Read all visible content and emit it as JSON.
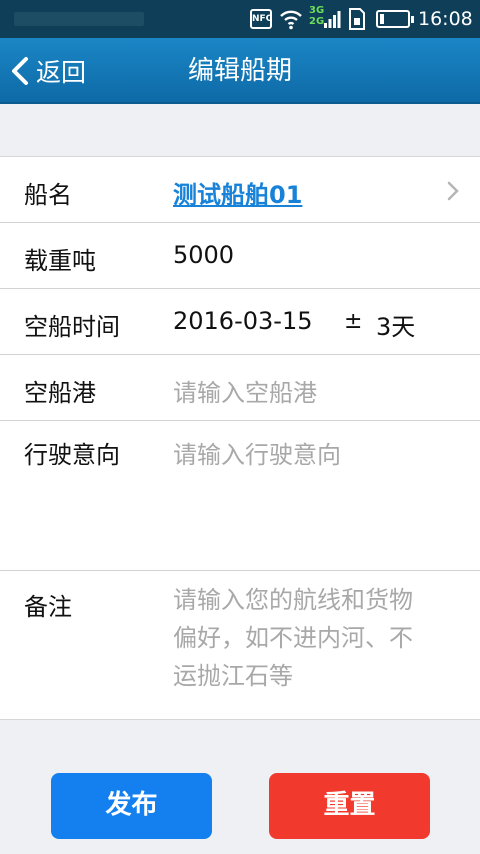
{
  "status_bar": {
    "nfc_label": "NFC",
    "network_type_top": "3G",
    "network_type_bottom": "2G",
    "battery_level_percent": 15,
    "time": "16:08"
  },
  "header": {
    "back_label": "返回",
    "title": "编辑船期"
  },
  "form": {
    "ship_name": {
      "label": "船名",
      "value": "测试船舶01"
    },
    "tonnage": {
      "label": "载重吨",
      "value": "5000"
    },
    "empty_time": {
      "label": "空船时间",
      "date": "2016-03-15",
      "plus_minus": "±",
      "days": "3天"
    },
    "empty_port": {
      "label": "空船港",
      "placeholder": "请输入空船港"
    },
    "intention": {
      "label": "行驶意向",
      "placeholder": "请输入行驶意向"
    },
    "remarks": {
      "label": "备注",
      "placeholder_lines": [
        "请输入您的航线和货物",
        "偏好，如不进内河、不",
        "运抛江石等"
      ]
    }
  },
  "actions": {
    "publish_label": "发布",
    "reset_label": "重置"
  },
  "colors": {
    "header_bg": "#1479b8",
    "link": "#1782d8",
    "publish": "#1480f0",
    "reset": "#f2392e"
  }
}
